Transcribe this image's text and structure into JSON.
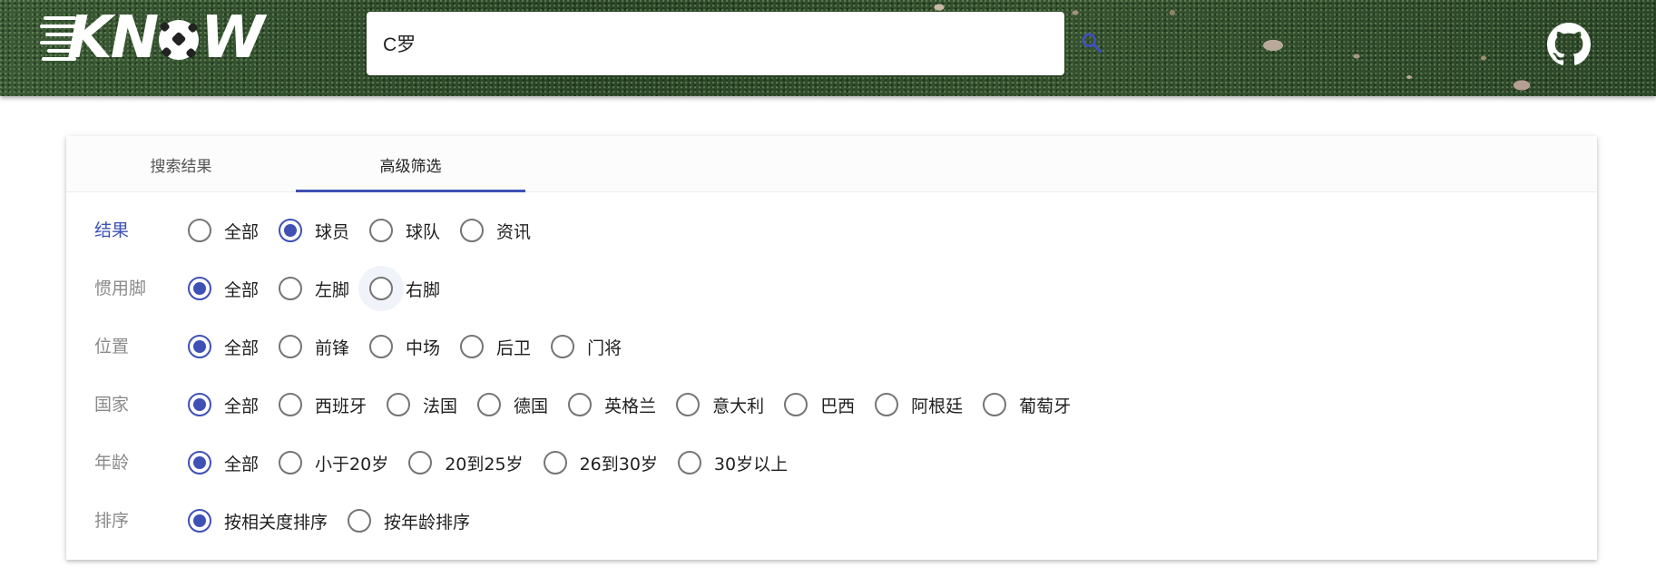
{
  "header": {
    "logo_text": "KNOW",
    "search": {
      "value": "C罗",
      "placeholder": ""
    },
    "icons": [
      "search-icon",
      "github-icon",
      "soccer-ball-icon"
    ],
    "accent_color": "#3f51b5"
  },
  "tabs": [
    {
      "label": "搜索结果",
      "active": false
    },
    {
      "label": "高级筛选",
      "active": true
    }
  ],
  "filters": [
    {
      "label": "结果",
      "options": [
        "全部",
        "球员",
        "球队",
        "资讯"
      ],
      "selected": "球员"
    },
    {
      "label": "惯用脚",
      "options": [
        "全部",
        "左脚",
        "右脚"
      ],
      "selected": "全部"
    },
    {
      "label": "位置",
      "options": [
        "全部",
        "前锋",
        "中场",
        "后卫",
        "门将"
      ],
      "selected": "全部"
    },
    {
      "label": "国家",
      "options": [
        "全部",
        "西班牙",
        "法国",
        "德国",
        "英格兰",
        "意大利",
        "巴西",
        "阿根廷",
        "葡萄牙"
      ],
      "selected": "全部"
    },
    {
      "label": "年龄",
      "options": [
        "全部",
        "小于20岁",
        "20到25岁",
        "26到30岁",
        "30岁以上"
      ],
      "selected": "全部"
    },
    {
      "label": "排序",
      "options": [
        "按相关度排序",
        "按年龄排序"
      ],
      "selected": "按相关度排序"
    }
  ]
}
